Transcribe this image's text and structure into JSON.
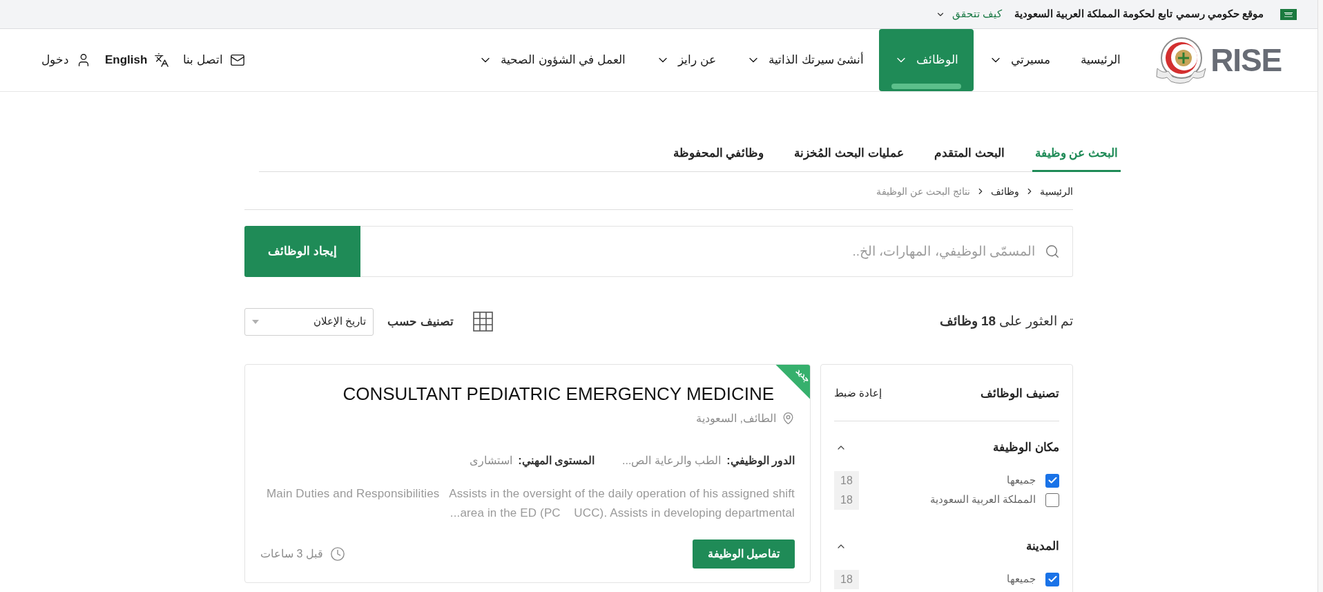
{
  "gov_banner": {
    "text": "موقع حكومي رسمي تابع لحكومة المملكة العربية السعودية",
    "link": "كيف تتحقق"
  },
  "header": {
    "logo": "RISE",
    "nav": [
      {
        "label": "الرئيسية",
        "dropdown": false,
        "selected": false
      },
      {
        "label": "مسيرتي",
        "dropdown": true,
        "selected": false
      },
      {
        "label": "الوظائف",
        "dropdown": true,
        "selected": true
      },
      {
        "label": "أنشئ سيرتك الذاتية",
        "dropdown": true,
        "selected": false
      },
      {
        "label": "عن رايز",
        "dropdown": true,
        "selected": false
      },
      {
        "label": "العمل في الشؤون الصحية",
        "dropdown": true,
        "selected": false
      }
    ],
    "actions": [
      {
        "kind": "contact",
        "label": "اتصل بنا"
      },
      {
        "kind": "language",
        "label": "English"
      },
      {
        "kind": "login",
        "label": "دخول"
      }
    ]
  },
  "tabs": [
    {
      "label": "البحث عن وظيفة",
      "selected": true
    },
    {
      "label": "البحث المتقدم",
      "selected": false
    },
    {
      "label": "عمليات البحث المُخزنة",
      "selected": false
    },
    {
      "label": "وظائفي المحفوظة",
      "selected": false
    }
  ],
  "breadcrumb": [
    {
      "label": "الرئيسية",
      "current": false
    },
    {
      "label": "وظائف",
      "current": false
    },
    {
      "label": "نتائج البحث عن الوظيفة",
      "current": true
    }
  ],
  "search": {
    "placeholder": "المسمّى الوظيفي، المهارات، الخ..",
    "button": "إيجاد الوظائف"
  },
  "results": {
    "summary": "تم العثور على **18 وظائف**",
    "sort_label": "تصنيف حسب",
    "sort_value": "تاريخ الإعلان"
  },
  "filters": {
    "title": "تصنيف الوظائف",
    "reset": "إعادة ضبط",
    "sections": [
      {
        "title": "مكان الوظيفة",
        "expanded": true,
        "options": [
          {
            "label": "جميعها",
            "count": "18",
            "checked": true
          },
          {
            "label": "المملكة العربية السعودية",
            "count": "18",
            "checked": false
          }
        ]
      },
      {
        "title": "المدينة",
        "expanded": true,
        "options": [
          {
            "label": "جميعها",
            "count": "18",
            "checked": true
          }
        ]
      }
    ]
  },
  "jobs": [
    {
      "title": "CONSULTANT PEDIATRIC EMERGENCY MEDICINE",
      "badge": "جديد",
      "location": "الطائف, السعودية",
      "meta": [
        {
          "label": "الدور الوظيفي:",
          "value": "الطب والرعاية الص..."
        },
        {
          "label": "المستوى المهني:",
          "value": "استشارى"
        }
      ],
      "description": "Main Duties and Responsibilities   Assists in the oversight of the daily operation of his assigned shift area in the ED (PC    UCC). Assists in developing departmental...",
      "button": "تفاصيل الوظيفة",
      "posted": "قبل 3 ساعات"
    }
  ]
}
